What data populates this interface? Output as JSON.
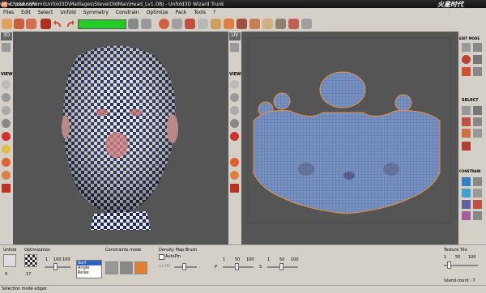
{
  "window": {
    "title": "C:\\Users\\Rémi\\Unfold3D\\Maillages\\Steve\\OldMan\\Head_Lv1.OBJ - Unfold3D Wizard Trunk",
    "brand": "火星时代",
    "brand_url": "www.hxsd.com"
  },
  "menu": [
    "Files",
    "Edit",
    "Select",
    "Unfold",
    "Symmetry",
    "Constrain",
    "Optimize",
    "Pack",
    "Tools",
    "?"
  ],
  "left_sidebar": {
    "tab": "3D",
    "view_label": "VIEW"
  },
  "uv_sidebar": {
    "tab": "UV",
    "view_label": "VIEW"
  },
  "right_sidebar": {
    "edit_label": "EDIT MODE",
    "select_label": "SELECT",
    "constrain_label": "CONSTRAIN"
  },
  "bottom": {
    "unfold_label": "Unfold",
    "unfold_value": "0",
    "optimization_label": "Optimization",
    "opt_min": "1",
    "opt_max": "100",
    "opt_max2": "100",
    "opt_value": "17",
    "opt_options": [
      "Surf",
      "Angle",
      "Relax"
    ],
    "opt_selected": "Surf",
    "constraints_label": "Constraints mode",
    "density_label": "Density Map Brush",
    "autopin_label": "AutoPin",
    "density_value": "x2.00",
    "p_label": "P",
    "p_min": "1",
    "p_mid": "50",
    "p_max": "100",
    "s_label": "S",
    "s_min": "1",
    "s_mid": "50",
    "s_max": "100",
    "texture_tile_label": "Texture Tile",
    "tt_min": "1",
    "tt_mid": "50",
    "tt_max": "100",
    "island_count": "Island count : 7"
  },
  "status": "Selection mode edges",
  "colors": {
    "progress": "#22cc22",
    "viewport_bg": "#555555",
    "checker_a": "#1e2a55",
    "checker_b": "#e8e8e8",
    "uv_fill": "#7690c0",
    "uv_edge": "#e89040"
  }
}
